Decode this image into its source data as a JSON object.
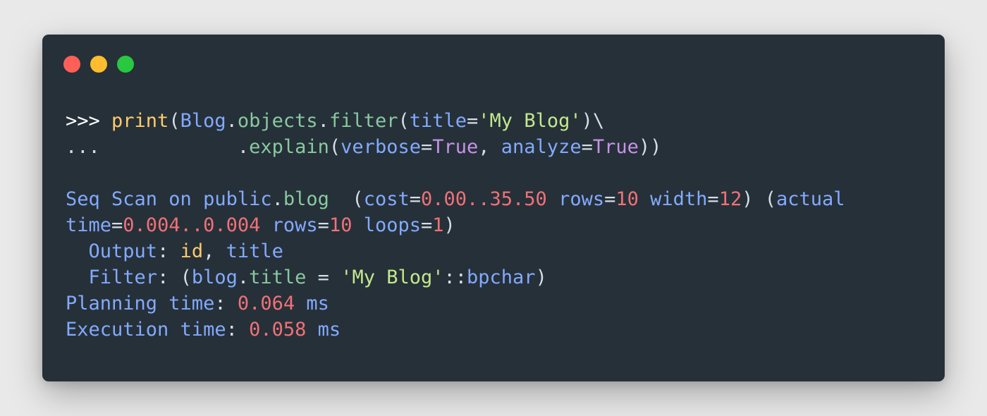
{
  "colors": {
    "window_bg": "#263038",
    "red_light": "#ff5f57",
    "yellow_light": "#febc2e",
    "green_light": "#28c840",
    "plain": "#d5dde6",
    "blue": "#82aaff",
    "green": "#88c9a0",
    "yellow": "#ffcb6b",
    "string": "#c3e88d",
    "number": "#f07178",
    "purple": "#c792ea",
    "prompt": "#ffffff"
  },
  "window_controls": [
    "close",
    "minimize",
    "maximize"
  ],
  "lines": [
    [
      {
        "text": ">>> ",
        "color": "prompt"
      },
      {
        "text": "print",
        "color": "yellow"
      },
      {
        "text": "(",
        "color": "plain"
      },
      {
        "text": "Blog",
        "color": "blue"
      },
      {
        "text": ".",
        "color": "plain"
      },
      {
        "text": "objects",
        "color": "green"
      },
      {
        "text": ".",
        "color": "plain"
      },
      {
        "text": "filter",
        "color": "green"
      },
      {
        "text": "(",
        "color": "plain"
      },
      {
        "text": "title",
        "color": "blue"
      },
      {
        "text": "=",
        "color": "plain"
      },
      {
        "text": "'My Blog'",
        "color": "string"
      },
      {
        "text": ")\\",
        "color": "plain"
      }
    ],
    [
      {
        "text": "...            ",
        "color": "plain"
      },
      {
        "text": ".",
        "color": "plain"
      },
      {
        "text": "explain",
        "color": "green"
      },
      {
        "text": "(",
        "color": "plain"
      },
      {
        "text": "verbose",
        "color": "blue"
      },
      {
        "text": "=",
        "color": "plain"
      },
      {
        "text": "True",
        "color": "purple"
      },
      {
        "text": ", ",
        "color": "plain"
      },
      {
        "text": "analyze",
        "color": "blue"
      },
      {
        "text": "=",
        "color": "plain"
      },
      {
        "text": "True",
        "color": "purple"
      },
      {
        "text": "))",
        "color": "plain"
      }
    ],
    [],
    [
      {
        "text": "Seq Scan on public",
        "color": "blue"
      },
      {
        "text": ".",
        "color": "plain"
      },
      {
        "text": "blog",
        "color": "green"
      },
      {
        "text": "  (",
        "color": "plain"
      },
      {
        "text": "cost",
        "color": "blue"
      },
      {
        "text": "=",
        "color": "plain"
      },
      {
        "text": "0.00..35.50",
        "color": "number"
      },
      {
        "text": " ",
        "color": "plain"
      },
      {
        "text": "rows",
        "color": "blue"
      },
      {
        "text": "=",
        "color": "plain"
      },
      {
        "text": "10",
        "color": "number"
      },
      {
        "text": " ",
        "color": "plain"
      },
      {
        "text": "width",
        "color": "blue"
      },
      {
        "text": "=",
        "color": "plain"
      },
      {
        "text": "12",
        "color": "number"
      },
      {
        "text": ") (",
        "color": "plain"
      },
      {
        "text": "actual",
        "color": "blue"
      }
    ],
    [
      {
        "text": "time",
        "color": "blue"
      },
      {
        "text": "=",
        "color": "plain"
      },
      {
        "text": "0.004..0.004",
        "color": "number"
      },
      {
        "text": " ",
        "color": "plain"
      },
      {
        "text": "rows",
        "color": "blue"
      },
      {
        "text": "=",
        "color": "plain"
      },
      {
        "text": "10",
        "color": "number"
      },
      {
        "text": " ",
        "color": "plain"
      },
      {
        "text": "loops",
        "color": "blue"
      },
      {
        "text": "=",
        "color": "plain"
      },
      {
        "text": "1",
        "color": "number"
      },
      {
        "text": ")",
        "color": "plain"
      }
    ],
    [
      {
        "text": "  ",
        "color": "plain"
      },
      {
        "text": "Output",
        "color": "blue"
      },
      {
        "text": ": ",
        "color": "plain"
      },
      {
        "text": "id",
        "color": "yellow"
      },
      {
        "text": ", ",
        "color": "plain"
      },
      {
        "text": "title",
        "color": "blue"
      }
    ],
    [
      {
        "text": "  ",
        "color": "plain"
      },
      {
        "text": "Filter",
        "color": "blue"
      },
      {
        "text": ": (",
        "color": "plain"
      },
      {
        "text": "blog",
        "color": "blue"
      },
      {
        "text": ".",
        "color": "plain"
      },
      {
        "text": "title",
        "color": "green"
      },
      {
        "text": " = ",
        "color": "plain"
      },
      {
        "text": "'My Blog'",
        "color": "string"
      },
      {
        "text": "::",
        "color": "plain"
      },
      {
        "text": "bpchar",
        "color": "blue"
      },
      {
        "text": ")",
        "color": "plain"
      }
    ],
    [
      {
        "text": "Planning time",
        "color": "blue"
      },
      {
        "text": ": ",
        "color": "plain"
      },
      {
        "text": "0.064",
        "color": "number"
      },
      {
        "text": " ",
        "color": "plain"
      },
      {
        "text": "ms",
        "color": "blue"
      }
    ],
    [
      {
        "text": "Execution time",
        "color": "blue"
      },
      {
        "text": ": ",
        "color": "plain"
      },
      {
        "text": "0.058",
        "color": "number"
      },
      {
        "text": " ",
        "color": "plain"
      },
      {
        "text": "ms",
        "color": "blue"
      }
    ]
  ]
}
